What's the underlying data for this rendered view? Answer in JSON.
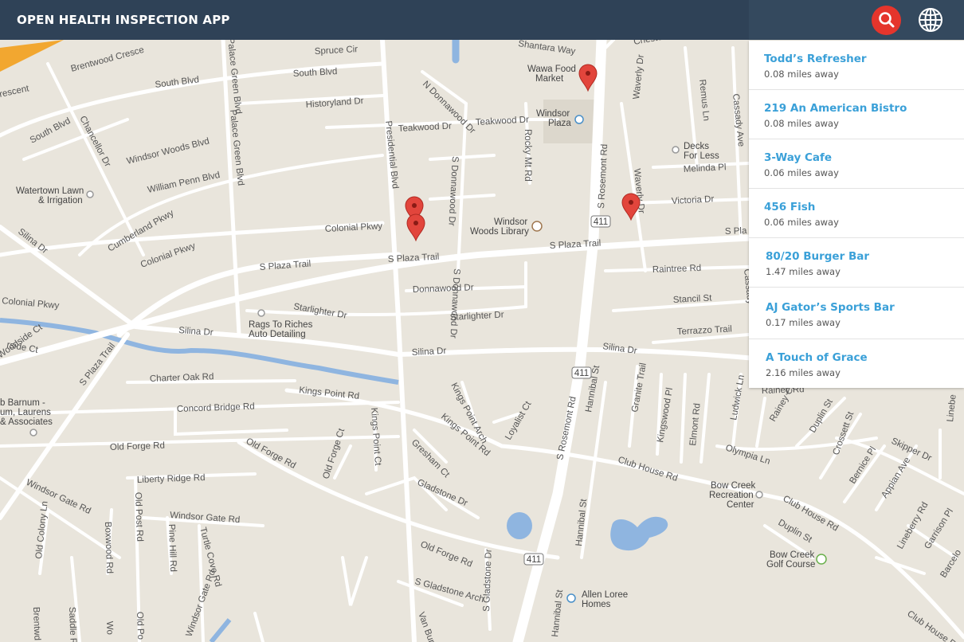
{
  "header": {
    "title": "OPEN HEALTH INSPECTION APP"
  },
  "icons": {
    "search": "search-icon",
    "globe": "globe-icon",
    "marker": "map-marker-icon"
  },
  "colors": {
    "topbar": "#2f4257",
    "accent": "#e5352c",
    "link": "#3aa0d8"
  },
  "results": [
    {
      "name": "Todd’s Refresher",
      "distance": "0.08 miles away"
    },
    {
      "name": "219 An American Bistro",
      "distance": "0.08 miles away"
    },
    {
      "name": "3-Way Cafe",
      "distance": "0.06 miles away"
    },
    {
      "name": "456 Fish",
      "distance": "0.06 miles away"
    },
    {
      "name": "80/20 Burger Bar",
      "distance": "1.47 miles away"
    },
    {
      "name": "AJ Gator’s Sports Bar",
      "distance": "0.17 miles away"
    },
    {
      "name": "A Touch of Grace",
      "distance": "2.16 miles away"
    }
  ],
  "map": {
    "streets": {
      "south_blvd": "South Blvd",
      "brentwood": "Brentwood Cresce",
      "spruce_cir": "Spruce Cir",
      "historyland": "Historyland Dr",
      "teakwood1": "Teakwood Dr",
      "teakwood2": "Teakwood Dr",
      "n_donnawood": "N Donnawood Dr",
      "presidential": "Presidential Blvd",
      "palace_green": "Palace Green Blvd",
      "chancellor": "Chancellor Dr",
      "windsor_woods": "Windsor Woods Blvd",
      "william_penn": "William Penn Blvd",
      "cumberland": "Cumberland Pkwy",
      "colonial1": "Colonial Pkwy",
      "colonial2": "Colonial Pkwy",
      "colonial3": "Colonial Pkwy",
      "silina1": "Silina Dr",
      "silina2": "Silina Dr",
      "silina3": "Silina Dr",
      "silina4": "Silina Dr",
      "s_plaza1": "S Plaza Trail",
      "s_plaza2": "S Plaza Trail",
      "s_plaza3": "S Plaza Trail",
      "s_plaza4": "S Plaza Trail",
      "s_plaza5": "S Pla",
      "donnawood": "Donnawood Dr",
      "s_donnawood": "S Donnawood Dr",
      "starlighter1": "Starlighter Dr",
      "starlighter2": "Starlighter Dr",
      "rocky_mt": "Rocky Mt Rd",
      "s_rosemont1": "S Rosemont Rd",
      "s_rosemont2": "S Rosemont Rd",
      "waverly1": "Waverly Dr",
      "waverly2": "Waverly Dr",
      "chester": "Chester",
      "remus": "Remus Ln",
      "cassady1": "Cassady Ave",
      "cassady2": "Cassady",
      "melinda": "Melinda Pl",
      "victoria": "Victoria Dr",
      "raintree": "Raintree Rd",
      "stancil": "Stancil St",
      "terrazzo": "Terrazzo Trail",
      "shantara": "Shantara Way",
      "charter_oak": "Charter Oak Rd",
      "concord": "Concord Bridge Rd",
      "kings_point1": "Kings Point Rd",
      "kings_point2": "Kings Point Rd",
      "kings_point_ct": "Kings Point Ct",
      "kings_point_arch": "Kings Point Arch",
      "loyalist": "Loyalist Ct",
      "gresham": "Gresham Ct",
      "old_forge1": "Old Forge Rd",
      "old_forge2": "Old Forge Rd",
      "old_forge3": "Old Forge Rd",
      "old_forge_ct": "Old Forge Ct",
      "liberty_ridge": "Liberty Ridge Rd",
      "windsor_gate1": "Windsor Gate Rd",
      "windsor_gate2": "Windsor Gate Rd",
      "windsor_gate3": "Windsor Gate Rd",
      "gladstone1": "Gladstone Dr",
      "gladstone2": "S Gladstone Dr",
      "gladstone_arch": "S Gladstone Arch",
      "hannibal1": "Hannibal St",
      "hannibal2": "Hannibal St",
      "hannibal3": "Hannibal St",
      "granite": "Granite Trail",
      "kingswood": "Kingswood Pl",
      "elmont": "Elmont Rd",
      "ludwick": "Ludwick Ln",
      "rainey_ct": "Rainey Ct",
      "rainey_rd": "Rainey Rd",
      "duplin1": "Duplin St",
      "duplin2": "Duplin St",
      "crossett": "Crossett St",
      "skipper": "Skipper Dr",
      "bernice": "Bernice Pl",
      "appian": "Appian Ave",
      "lineberry1": "Lineberry Rd",
      "lineberry2": "Linebe",
      "garrison": "Garrison Pl",
      "barcelo": "Barcelo",
      "olympia": "Olympia Ln",
      "club_house1": "Club House Rd",
      "club_house2": "Club House Rd",
      "club_house3": "Club House Rd",
      "van_buren": "Van Buren",
      "old_colony": "Old Colony Ln",
      "boxwood": "Boxwood Rd",
      "old_post": "Old Post Rd",
      "pine_hill": "Pine Hill Rd",
      "turtle_cove": "Turtle Cove Rd",
      "woodside": "Woodside Ct",
      "brentwd": "Brentwd",
      "saddle": "Saddle R",
      "wo": "Wo",
      "old_po": "Old Po",
      "escent": "rescent",
      "rside": "rside Ct",
      "route_411": "411"
    },
    "places": {
      "wawa1": "Wawa Food",
      "wawa2": "Market",
      "windsor_plaza1": "Windsor",
      "windsor_plaza2": "Plaza",
      "decks1": "Decks",
      "decks2": "For Less",
      "watertown1": "Watertown Lawn",
      "watertown2": "& Irrigation",
      "library1": "Windsor",
      "library2": "Woods Library",
      "rags1": "Rags To Riches",
      "rags2": "Auto Detailing",
      "barnum1": "b Barnum -",
      "barnum2": "um, Laurens",
      "barnum3": "& Associates",
      "bow_creek_rec1": "Bow Creek",
      "bow_creek_rec2": "Recreation",
      "bow_creek_rec3": "Center",
      "golf1": "Bow Creek",
      "golf2": "Golf Course",
      "allen1": "Allen Loree",
      "allen2": "Homes"
    }
  }
}
